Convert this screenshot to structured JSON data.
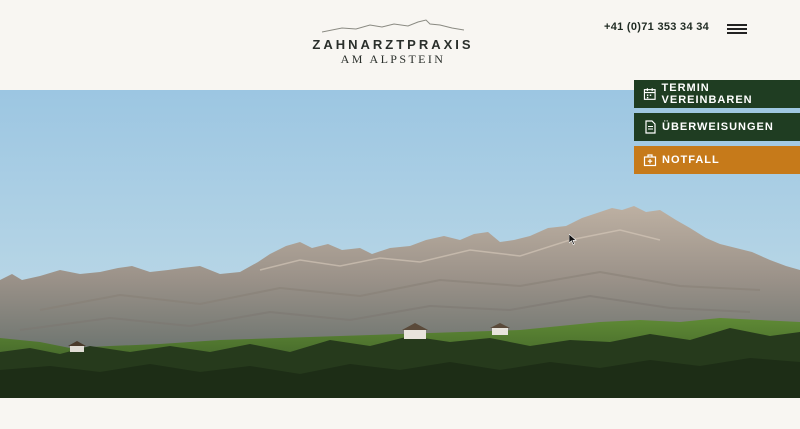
{
  "header": {
    "logo_line1": "ZAHNARZTPRAXIS",
    "logo_line2": "AM ALPSTEIN",
    "phone": "+41 (0)71 353 34 34",
    "menu_icon": "hamburger-menu-icon"
  },
  "cta": {
    "termin_label": "TERMIN VEREINBAREN",
    "termin_icon": "calendar-icon",
    "ueberweisungen_label": "ÜBERWEISUNGEN",
    "ueberweisungen_icon": "document-icon",
    "notfall_label": "NOTFALL",
    "notfall_icon": "first-aid-kit-icon"
  },
  "hero": {
    "image_subject": "mountain-landscape"
  },
  "colors": {
    "background": "#f8f6f2",
    "brand_green": "#1f3d22",
    "accent_orange": "#c67a1a",
    "text_dark": "#1f2a22"
  }
}
